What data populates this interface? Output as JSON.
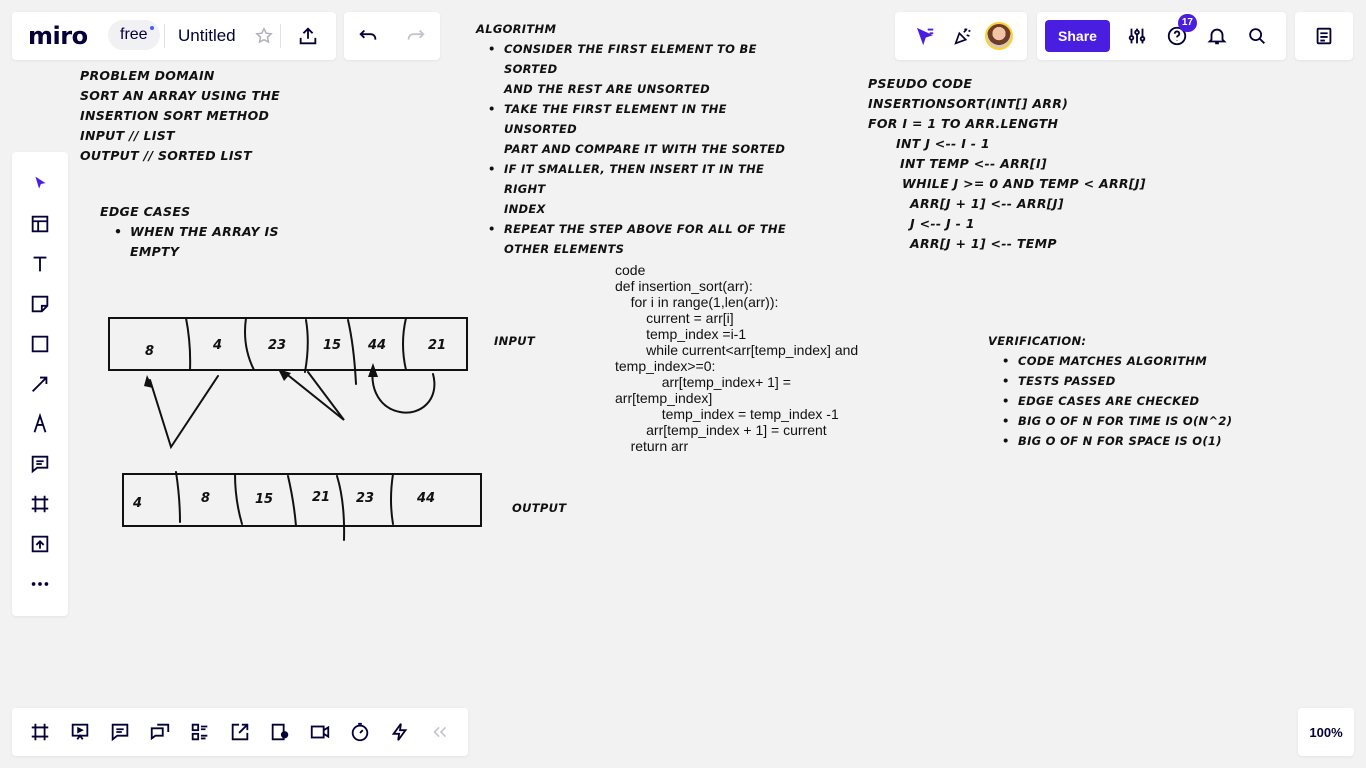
{
  "header": {
    "logo": "miro",
    "plan_badge": "free",
    "board_title": "Untitled",
    "share_label": "Share",
    "help_count": "17"
  },
  "zoom": "100%",
  "canvas": {
    "problem_domain": [
      "PROBLEM DOMAIN",
      "SORT AN ARRAY USING THE",
      "INSERTION SORT METHOD",
      "INPUT // LIST",
      "OUTPUT // SORTED LIST"
    ],
    "edge_cases": {
      "title": "EDGE CASES",
      "items": [
        "WHEN THE ARRAY IS",
        "EMPTY"
      ]
    },
    "algorithm": {
      "title": "ALGORITHM",
      "items": [
        [
          "CONSIDER THE FIRST ELEMENT TO BE SORTED",
          "AND THE REST ARE UNSORTED"
        ],
        [
          "TAKE THE FIRST ELEMENT IN THE UNSORTED",
          "PART AND COMPARE IT WITH THE SORTED"
        ],
        [
          "IF IT SMALLER, THEN INSERT IT IN THE RIGHT",
          "INDEX"
        ],
        [
          "REPEAT THE STEP ABOVE FOR ALL OF THE",
          "OTHER ELEMENTS"
        ]
      ]
    },
    "pseudo_code": [
      "PSEUDO CODE",
      "INSERTIONSORT(INT[] ARR)",
      "FOR I = 1 TO ARR.LENGTH",
      "INT J <-- I - 1",
      "INT TEMP <-- ARR[I]",
      "WHILE J >= 0 AND TEMP < ARR[J]",
      "ARR[J + 1] <-- ARR[J]",
      "J <-- J - 1",
      "ARR[J + 1] <-- TEMP"
    ],
    "code": [
      "code",
      "def insertion_sort(arr):",
      "    for i in range(1,len(arr)):",
      "        current = arr[i]",
      "        temp_index =i-1",
      "        while current<arr[temp_index] and",
      "temp_index>=0:",
      "            arr[temp_index+ 1] =",
      "arr[temp_index]",
      "            temp_index = temp_index -1",
      "        arr[temp_index + 1] = current",
      "    return arr"
    ],
    "verification": {
      "title": "VERIFICATION:",
      "items": [
        "CODE MATCHES ALGORITHM",
        "TESTS PASSED",
        "EDGE CASES ARE CHECKED",
        "BIG O OF N FOR TIME IS O(N^2)",
        "BIG O OF N FOR SPACE IS O(1)"
      ]
    },
    "input_label": "INPUT",
    "output_label": "OUTPUT",
    "input_values": [
      "8",
      "4",
      "23",
      "15",
      "44",
      "21"
    ],
    "output_values": [
      "4",
      "8",
      "15",
      "21",
      "23",
      "44"
    ]
  }
}
